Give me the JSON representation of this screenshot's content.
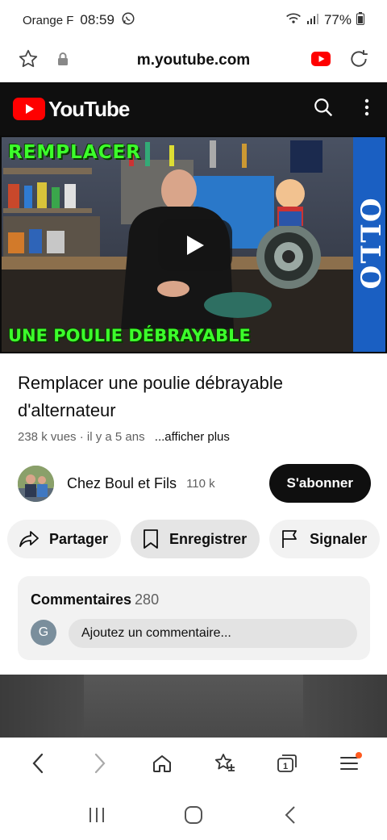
{
  "status_bar": {
    "carrier": "Orange F",
    "time": "08:59",
    "battery": "77%"
  },
  "browser": {
    "url": "m.youtube.com"
  },
  "youtube": {
    "logo_text": "YouTube"
  },
  "video": {
    "thumbnail_top_text": "REMPLACER",
    "thumbnail_bottom_text": "UNE POULIE DÉBRAYABLE",
    "thumbnail_side_text": "OLLO",
    "title": "Remplacer une poulie débrayable d'alternateur",
    "views": "238 k vues",
    "age": "il y a 5 ans",
    "separator": " · ",
    "more_label": "...afficher plus"
  },
  "channel": {
    "name": "Chez Boul et Fils",
    "subscribers": "110 k",
    "subscribe_label": "S'abonner"
  },
  "actions": {
    "share_label": "Partager",
    "save_label": "Enregistrer",
    "report_label": "Signaler"
  },
  "comments": {
    "heading": "Commentaires",
    "count": "280",
    "avatar_letter": "G",
    "input_placeholder": "Ajoutez un commentaire..."
  },
  "toolbar": {
    "tabs_count": "1"
  },
  "colors": {
    "youtube_red": "#ff0000",
    "subscribe_bg": "#0f0f0f",
    "thumbnail_text_green": "#3cff2b",
    "notification_dot": "#ff5a1f"
  },
  "icons": {
    "status": [
      "whatsapp-icon",
      "wifi-icon",
      "signal-icon",
      "battery-icon"
    ],
    "browser": [
      "bookmark-star-icon",
      "lock-icon",
      "youtube-app-icon",
      "reload-icon"
    ],
    "toolbar": [
      "back-icon",
      "forward-icon",
      "home-icon",
      "bookmarks-icon",
      "tabs-icon",
      "menu-icon"
    ],
    "android_nav": [
      "recents-icon",
      "home-circle-icon",
      "back-chevron-icon"
    ]
  }
}
